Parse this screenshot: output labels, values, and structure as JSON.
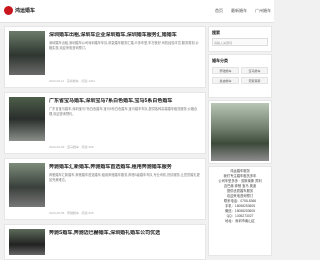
{
  "header": {
    "logo_text": "鸿运婚车",
    "nav": [
      "首页",
      "最新婚车",
      "广州婚车"
    ]
  },
  "articles": [
    {
      "title": "深圳婚车出租,深圳车企业深圳婚车,深圳婚车服务汇婚婚车",
      "desc": "深圳婚车出租,深圳婚车公司深圳婚车车队,帝豪婚车服务汇婚,众多车型,车况良好,司机经验丰富,服务周到,价格实惠,欢迎来电咨询预订。",
      "meta": "2024-06-11 · 深圳婚车 · 阅读 1321"
    },
    {
      "title": "广东省宝马婚车,深圳宝马7系白色婚车,宝马5系白色婚车",
      "desc": "广东省宝马婚车,深圳宝马7系白色婚车,宝马5系白色婚车,宝马婚车车队,提供各种高端婚车租赁服务,价格合理,欢迎咨询预约。",
      "meta": "2024-06-09 · 宝马婚车 · 阅读 968"
    },
    {
      "title": "奔驰婚车汇新婚车,奔驰婚车首选婚车,租用奔驰婚车服务",
      "desc": "奔驰婚车汇新婚车,奔驰婚车首选婚车,租用奔驰婚车服务,奔驰S级婚车车队,专业司机,热情服务,让您的婚礼更加完美难忘。",
      "meta": "2024-06-05 · 奔驰婚车 · 阅读 845"
    },
    {
      "title": "奔驰S婚车,奔驰迈巴赫婚车,深圳婚礼婚车公司优选",
      "desc": "",
      "meta": ""
    }
  ],
  "sidebar": {
    "search_title": "搜索",
    "search_placeholder": "请输入关键词",
    "tags_title": "婚车分类",
    "tags": [
      "奔驰婚车",
      "宝马婚车",
      "奥迪婚车",
      "劳斯莱斯"
    ],
    "contact_lines": [
      "鸿运婚车服务",
      "我们专注婚车租赁多年",
      "公司车型多多 · 劳斯莱斯 宾利",
      "迈巴赫 奔驰 宝马 奥迪",
      "提供优质婚车服务",
      "欢迎来电咨询预订",
      "联系电话：0755-8366",
      "手机：18058253605",
      "微信：18058253605",
      "QQ：1305273027",
      "地址：深圳市南山区"
    ]
  }
}
